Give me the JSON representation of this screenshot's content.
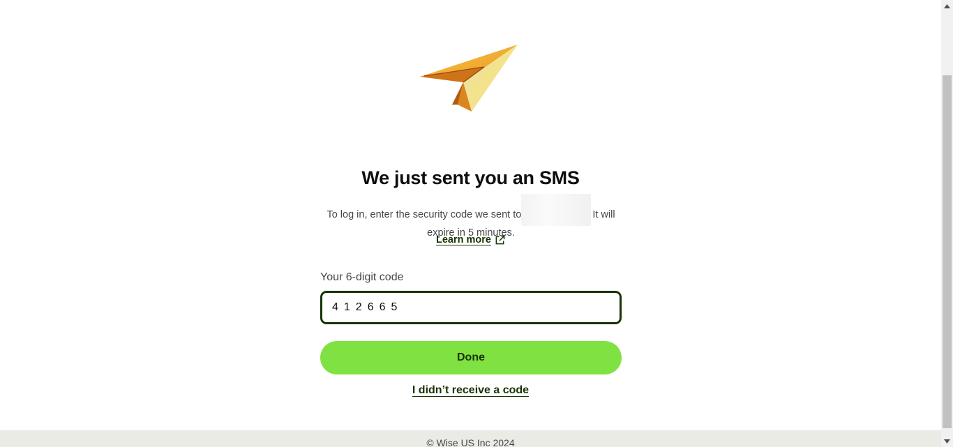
{
  "page": {
    "title": "We just sent you an SMS",
    "description_before": "To log in, enter the security code we sent to",
    "description_after": "It will expire in 5 minutes.",
    "learn_more": "Learn more",
    "code_label": "Your 6-digit code",
    "code_value": "412665",
    "done_label": "Done",
    "resend_label": "I didn’t receive a code"
  },
  "footer": {
    "copyright": "© Wise US Inc 2024"
  },
  "icons": {
    "illustration": "paper-plane-icon",
    "external": "external-link-icon"
  },
  "colors": {
    "accent": "#80e142",
    "forest": "#163300",
    "footer_bg": "#ebebe6"
  }
}
